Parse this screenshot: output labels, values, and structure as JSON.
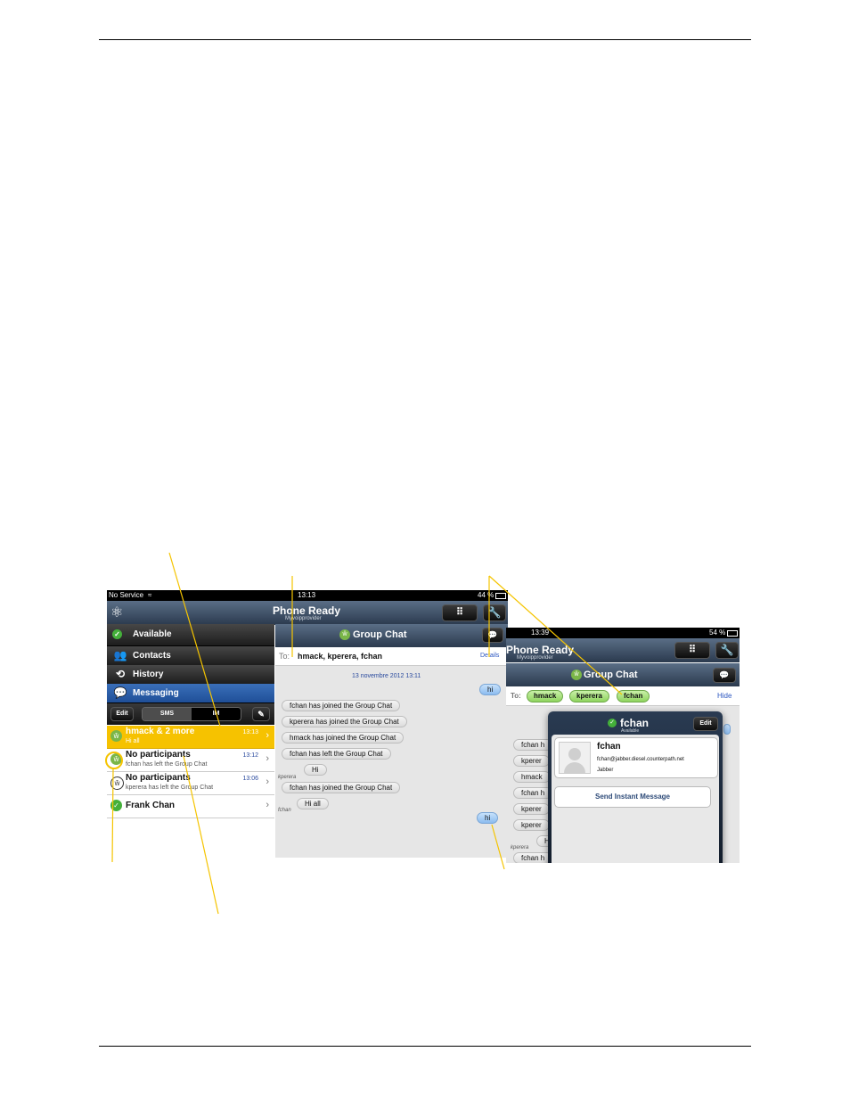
{
  "left_ipad": {
    "status": {
      "carrier": "No Service",
      "time": "13:13",
      "battery": "44 %"
    },
    "nav": {
      "title": "Phone Ready",
      "subtitle": "Myvoipprovider"
    },
    "chat_header": {
      "title": "Group Chat"
    },
    "sidebar": {
      "presence": "Available",
      "items": [
        {
          "label": "Contacts",
          "icon": "contacts-icon"
        },
        {
          "label": "History",
          "icon": "history-icon"
        },
        {
          "label": "Messaging",
          "icon": "messaging-icon"
        }
      ],
      "edit_label": "Edit",
      "segments": [
        "SMS",
        "IM"
      ]
    },
    "conversations": [
      {
        "name": "hmack & 2 more",
        "preview": "Hi all",
        "time": "13:13"
      },
      {
        "name": "No participants",
        "preview": "fchan has left the Group Chat",
        "time": "13:12"
      },
      {
        "name": "No participants",
        "preview": "kperera has left the Group Chat",
        "time": "13:06"
      },
      {
        "name": "Frank Chan",
        "preview": "",
        "time": ""
      }
    ],
    "to_bar": {
      "label": "To:",
      "value": "hmack, kperera, fchan",
      "details": "Details"
    },
    "date": "13 novembre 2012 13:11",
    "messages": [
      {
        "text": "hi"
      },
      {
        "text": "fchan has joined the Group Chat"
      },
      {
        "text": "kperera has joined the Group Chat"
      },
      {
        "text": "hmack has joined the Group Chat"
      },
      {
        "text": "fchan has left the Group Chat"
      },
      {
        "text": "Hi"
      },
      {
        "text": "fchan has joined the Group Chat"
      },
      {
        "text": "Hi all"
      },
      {
        "text": "hi"
      }
    ],
    "senders": [
      "kperera",
      "fchan"
    ]
  },
  "right_ipad": {
    "status": {
      "time": "13:39",
      "battery": "54 %"
    },
    "nav": {
      "title": "Phone Ready",
      "subtitle": "Myvoipprovider"
    },
    "chat_header": {
      "title": "Group Chat"
    },
    "to_bar": {
      "label": "To:",
      "participants": [
        "hmack",
        "kperera",
        "fchan"
      ],
      "hide": "Hide"
    },
    "background_rows": [
      "fchan h",
      "kperer",
      "hmack",
      "fchan h",
      "kperer",
      "kperer",
      "H",
      "fchan h"
    ],
    "background_sender": "kperera",
    "popover": {
      "name": "fchan",
      "status": "Available",
      "edit_label": "Edit",
      "contact_name": "fchan",
      "address": "fchan@jabber.diesel.counterpath.net",
      "service": "Jabber",
      "action": "Send Instant Message"
    }
  }
}
